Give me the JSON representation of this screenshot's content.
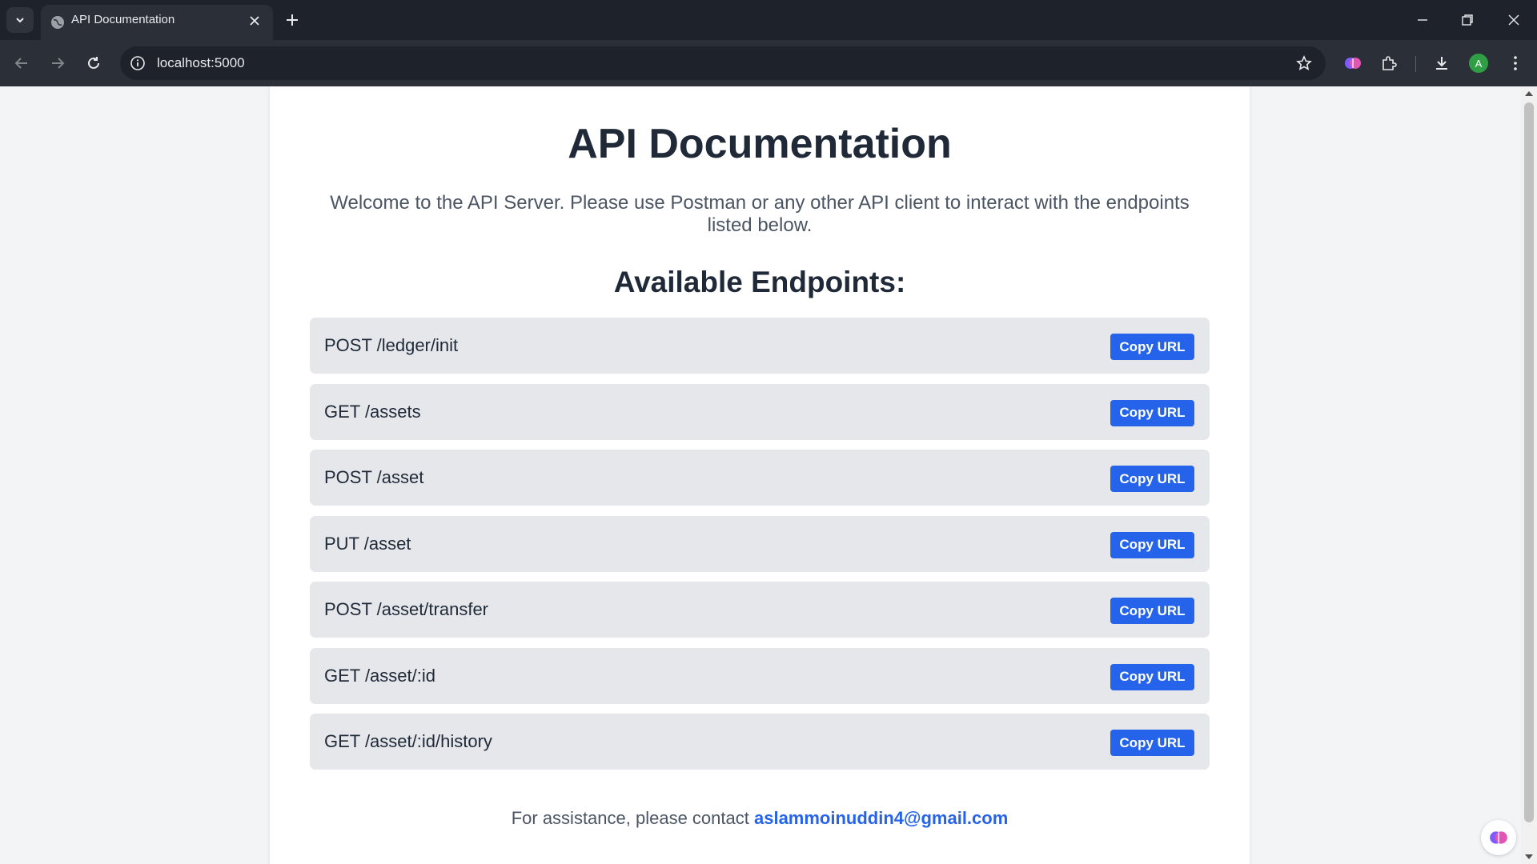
{
  "browser": {
    "tab_title": "API Documentation",
    "url": "localhost:5000",
    "avatar_letter": "A"
  },
  "page": {
    "title": "API Documentation",
    "intro": "Welcome to the API Server. Please use Postman or any other API client to interact with the endpoints listed below.",
    "section_title": "Available Endpoints:",
    "endpoints": [
      {
        "label": "POST /ledger/init",
        "button": "Copy URL"
      },
      {
        "label": "GET /assets",
        "button": "Copy URL"
      },
      {
        "label": "POST /asset",
        "button": "Copy URL"
      },
      {
        "label": "PUT /asset",
        "button": "Copy URL"
      },
      {
        "label": "POST /asset/transfer",
        "button": "Copy URL"
      },
      {
        "label": "GET /asset/:id",
        "button": "Copy URL"
      },
      {
        "label": "GET /asset/:id/history",
        "button": "Copy URL"
      }
    ],
    "footer_text": "For assistance, please contact",
    "footer_email": "aslammoinuddin4@gmail.com"
  },
  "colors": {
    "accent": "#2563eb",
    "heading": "#1f2937",
    "endpoint_bg": "#e5e7eb"
  },
  "icons": [
    "tab-list-icon",
    "globe-icon",
    "close-icon",
    "plus-icon",
    "minimize-icon",
    "restore-icon",
    "back-icon",
    "forward-icon",
    "reload-icon",
    "site-info-icon",
    "star-icon",
    "brain-extension-icon",
    "puzzle-icon",
    "download-icon",
    "more-icon"
  ]
}
